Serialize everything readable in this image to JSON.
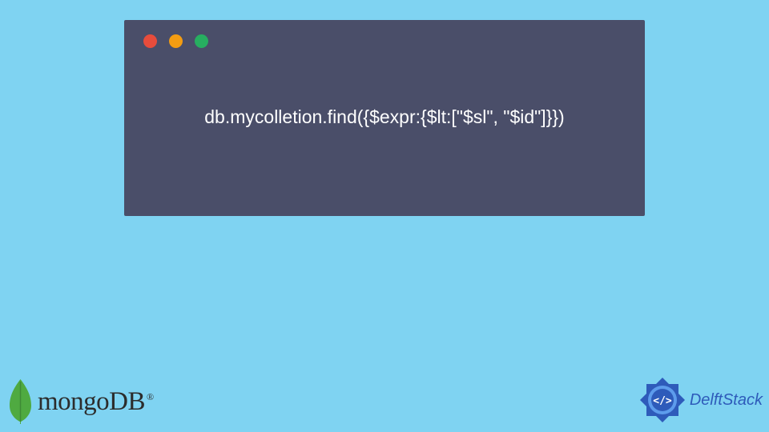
{
  "code": {
    "content": "db.mycolletion.find({$expr:{$lt:[\"$sl\", \"$id\"]}})"
  },
  "logos": {
    "mongodb": {
      "text": "mongoDB",
      "registered": "®"
    },
    "delftstack": {
      "text": "DelftStack"
    }
  },
  "colors": {
    "background": "#7FD3F2",
    "codeWindow": "#4A4E69",
    "codeText": "#FFFFFF",
    "dotRed": "#E74C3C",
    "dotYellow": "#F39C12",
    "dotGreen": "#27AE60",
    "mongoLeaf": "#4FAA41",
    "delftBlue": "#2E5BBA"
  }
}
